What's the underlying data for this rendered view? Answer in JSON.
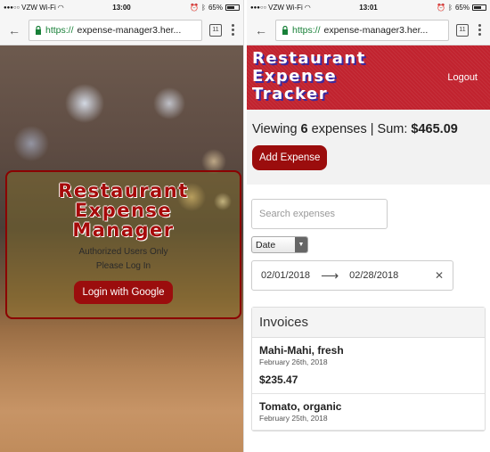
{
  "left": {
    "status": {
      "carrier": "VZW Wi-Fi",
      "time": "13:00",
      "battery": "65%"
    },
    "browser": {
      "scheme": "https://",
      "host": "expense-manager3.her...",
      "tab_count": "11"
    },
    "login": {
      "title_line1": "Restaurant",
      "title_line2": "Expense",
      "title_line3": "Manager",
      "note_line1": "Authorized Users Only",
      "note_line2": "Please Log In",
      "button_label": "Login with Google"
    }
  },
  "right": {
    "status": {
      "carrier": "VZW Wi-Fi",
      "time": "13:01",
      "battery": "65%"
    },
    "browser": {
      "scheme": "https://",
      "host": "expense-manager3.her...",
      "tab_count": "11"
    },
    "header": {
      "title_line1": "Restaurant",
      "title_line2": "Expense",
      "title_line3": "Tracker",
      "logout_label": "Logout"
    },
    "summary": {
      "prefix": "Viewing ",
      "count": "6",
      "middle": " expenses | Sum: ",
      "sum": "$465.09"
    },
    "add_button_label": "Add Expense",
    "search": {
      "placeholder": "Search expenses"
    },
    "sort_select": {
      "value": "Date"
    },
    "date_range": {
      "start": "02/01/2018",
      "end": "02/28/2018"
    },
    "invoices": {
      "heading": "Invoices",
      "items": [
        {
          "name": "Mahi-Mahi, fresh",
          "date": "February 26th, 2018",
          "amount": "$235.47"
        },
        {
          "name": "Tomato, organic",
          "date": "February 25th, 2018",
          "amount": ""
        }
      ]
    }
  }
}
